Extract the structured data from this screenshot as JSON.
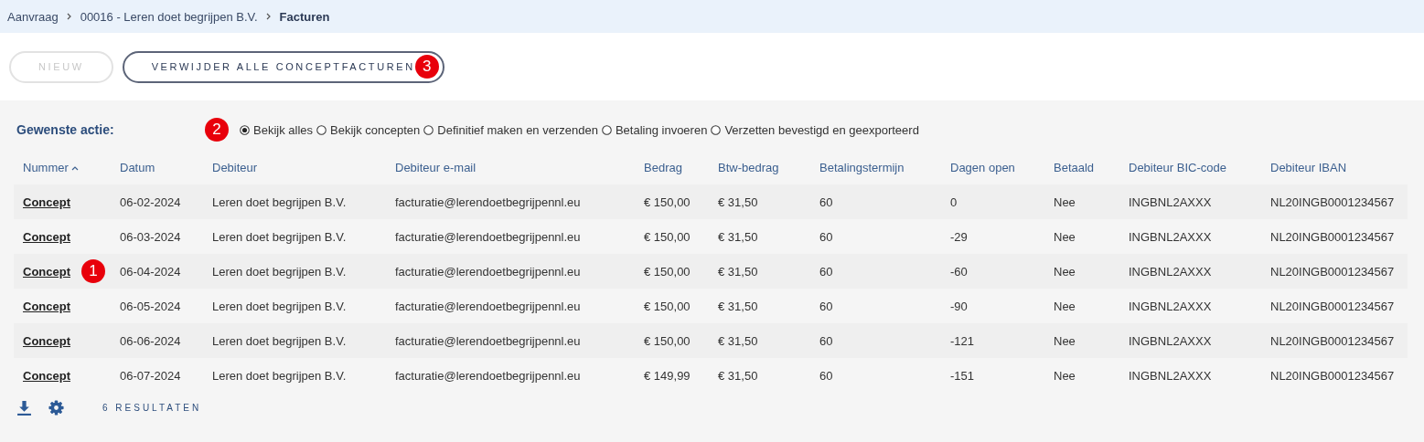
{
  "breadcrumb": [
    {
      "label": "Aanvraag",
      "current": false
    },
    {
      "label": "00016 - Leren doet begrijpen B.V.",
      "current": false
    },
    {
      "label": "Facturen",
      "current": true
    }
  ],
  "toolbar": {
    "buttons": [
      {
        "label": "NIEUW",
        "disabled": true
      },
      {
        "label": "VERWIJDER ALLE CONCEPTFACTUREN",
        "disabled": false,
        "badge": "3"
      }
    ]
  },
  "action": {
    "label": "Gewenste actie:",
    "badge": "2",
    "options": [
      {
        "label": "Bekijk alles",
        "selected": true
      },
      {
        "label": "Bekijk concepten",
        "selected": false
      },
      {
        "label": "Definitief maken en verzenden",
        "selected": false
      },
      {
        "label": "Betaling invoeren",
        "selected": false
      },
      {
        "label": "Verzetten bevestigd en geexporteerd",
        "selected": false
      }
    ]
  },
  "table": {
    "columns": [
      {
        "label": "Nummer",
        "sorted": true
      },
      {
        "label": "Datum"
      },
      {
        "label": "Debiteur"
      },
      {
        "label": "Debiteur e-mail"
      },
      {
        "label": "Bedrag"
      },
      {
        "label": "Btw-bedrag"
      },
      {
        "label": "Betalingstermijn"
      },
      {
        "label": "Dagen open"
      },
      {
        "label": "Betaald"
      },
      {
        "label": "Debiteur BIC-code"
      },
      {
        "label": "Debiteur IBAN"
      }
    ],
    "rows": [
      {
        "cells": [
          "Concept",
          "06-02-2024",
          "Leren doet begrijpen B.V.",
          "facturatie@lerendoetbegrijpennl.eu",
          "€ 150,00",
          "€ 31,50",
          "60",
          "0",
          "Nee",
          "INGBNL2AXXX",
          "NL20INGB0001234567"
        ]
      },
      {
        "cells": [
          "Concept",
          "06-03-2024",
          "Leren doet begrijpen B.V.",
          "facturatie@lerendoetbegrijpennl.eu",
          "€ 150,00",
          "€ 31,50",
          "60",
          "-29",
          "Nee",
          "INGBNL2AXXX",
          "NL20INGB0001234567"
        ]
      },
      {
        "cells": [
          "Concept",
          "06-04-2024",
          "Leren doet begrijpen B.V.",
          "facturatie@lerendoetbegrijpennl.eu",
          "€ 150,00",
          "€ 31,50",
          "60",
          "-60",
          "Nee",
          "INGBNL2AXXX",
          "NL20INGB0001234567"
        ],
        "badge": "1"
      },
      {
        "cells": [
          "Concept",
          "06-05-2024",
          "Leren doet begrijpen B.V.",
          "facturatie@lerendoetbegrijpennl.eu",
          "€ 150,00",
          "€ 31,50",
          "60",
          "-90",
          "Nee",
          "INGBNL2AXXX",
          "NL20INGB0001234567"
        ]
      },
      {
        "cells": [
          "Concept",
          "06-06-2024",
          "Leren doet begrijpen B.V.",
          "facturatie@lerendoetbegrijpennl.eu",
          "€ 150,00",
          "€ 31,50",
          "60",
          "-121",
          "Nee",
          "INGBNL2AXXX",
          "NL20INGB0001234567"
        ]
      },
      {
        "cells": [
          "Concept",
          "06-07-2024",
          "Leren doet begrijpen B.V.",
          "facturatie@lerendoetbegrijpennl.eu",
          "€ 149,99",
          "€ 31,50",
          "60",
          "-151",
          "Nee",
          "INGBNL2AXXX",
          "NL20INGB0001234567"
        ]
      }
    ]
  },
  "footer": {
    "count": "6 RESULTATEN"
  }
}
